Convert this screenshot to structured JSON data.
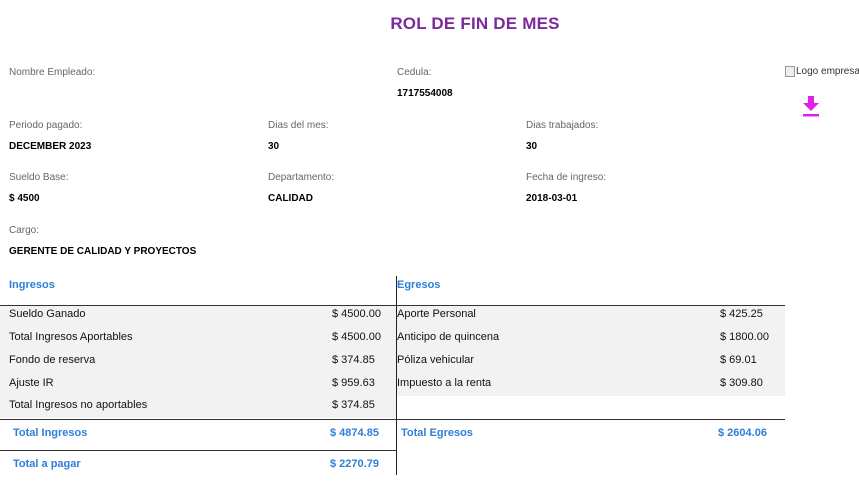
{
  "title": "ROL DE FIN DE MES",
  "employee": {
    "name_label": "Nombre Empleado:",
    "name_value": "",
    "cedula_label": "Cedula:",
    "cedula_value": "1717554008",
    "periodo_label": "Periodo pagado:",
    "periodo_value": "DECEMBER 2023",
    "dias_mes_label": "Dias del mes:",
    "dias_mes_value": "30",
    "dias_trab_label": "Dias trabajados:",
    "dias_trab_value": "30",
    "sueldo_label": "Sueldo Base:",
    "sueldo_value": "$ 4500",
    "depto_label": "Departamento:",
    "depto_value": "CALIDAD",
    "fecha_label": "Fecha de ingreso:",
    "fecha_value": "2018-03-01",
    "cargo_label": "Cargo:",
    "cargo_value": "GERENTE DE CALIDAD Y PROYECTOS"
  },
  "logo_alt": "Logo empresa",
  "download_icon": "download-arrow-icon",
  "accent_color": "#e020e8",
  "ingresos": {
    "header": "Ingresos",
    "rows": [
      {
        "label": "Sueldo Ganado",
        "amount": "$ 4500.00"
      },
      {
        "label": "Total Ingresos Aportables",
        "amount": "$ 4500.00"
      },
      {
        "label": "Fondo de reserva",
        "amount": "$ 374.85"
      },
      {
        "label": "Ajuste IR",
        "amount": "$ 959.63"
      },
      {
        "label": "Total Ingresos no aportables",
        "amount": "$ 374.85"
      }
    ],
    "total_label": "Total Ingresos",
    "total_amount": "$ 4874.85",
    "pagar_label": "Total a pagar",
    "pagar_amount": "$ 2270.79"
  },
  "egresos": {
    "header": "Egresos",
    "rows": [
      {
        "label": "Aporte Personal",
        "amount": "$ 425.25"
      },
      {
        "label": "Anticipo de quincena",
        "amount": "$ 1800.00"
      },
      {
        "label": "Póliza vehicular",
        "amount": "$ 69.01"
      },
      {
        "label": "Impuesto a la renta",
        "amount": "$ 309.80"
      }
    ],
    "total_label": "Total Egresos",
    "total_amount": "$ 2604.06"
  }
}
